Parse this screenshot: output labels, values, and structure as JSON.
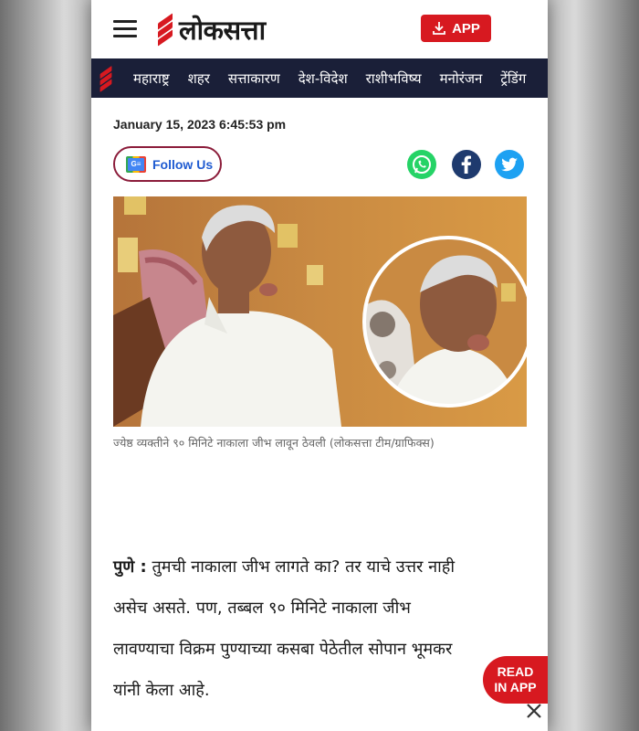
{
  "header": {
    "logo_text": "लोकसत्ता",
    "app_button_label": "APP",
    "brand_color": "#d71920"
  },
  "nav": {
    "items": [
      "महाराष्ट्र",
      "शहर",
      "सत्ताकारण",
      "देश-विदेश",
      "राशीभविष्य",
      "मनोरंजन",
      "ट्रेंडिंग"
    ],
    "background": "#1a1f38"
  },
  "article_meta": {
    "date": "January 15, 2023 6:45:53 pm",
    "follow_label": "Follow Us"
  },
  "share": {
    "icons": [
      "whatsapp-icon",
      "facebook-icon",
      "twitter-icon"
    ]
  },
  "image": {
    "caption": "ज्येष्ठ व्यक्तीने ९० मिनिटे नाकाला जीभ लावून ठेवली (लोकसत्ता टीम/ग्राफिक्स)"
  },
  "article": {
    "lead_bold": "पुणे :",
    "lines": [
      "तुमची नाकाला जीभ लागते का? तर याचे उत्तर नाही",
      "असेच असते. पण, तब्बल ९० मिनिटे नाकाला जीभ",
      "लावण्याचा विक्रम पुण्याच्या कसबा पेठेतील सोपान भूमकर",
      "यांनी केला आहे."
    ]
  },
  "read_in_app": {
    "line1": "READ",
    "line2": "IN APP"
  }
}
